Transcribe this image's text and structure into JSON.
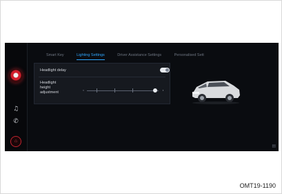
{
  "tabs": [
    {
      "label": "Smart Key"
    },
    {
      "label": "Lighting Settings"
    },
    {
      "label": "Driver Assistance Settings"
    },
    {
      "label": "Personalised Sett"
    }
  ],
  "panel": {
    "headlight_delay_label": "Headlight delay",
    "headlight_delay_on": true,
    "height_adjust_label": [
      "Headlight",
      "height",
      "adjustment"
    ],
    "height_adjust_value": 0.95
  },
  "rail": {
    "music_icon": "♫",
    "phone_icon": "✆",
    "home_icon": "⌂"
  },
  "corner_icon": "▤",
  "caption": "OMT19-1190",
  "colors": {
    "accent": "#2fa7ff",
    "brand_red": "#d21e2b"
  }
}
